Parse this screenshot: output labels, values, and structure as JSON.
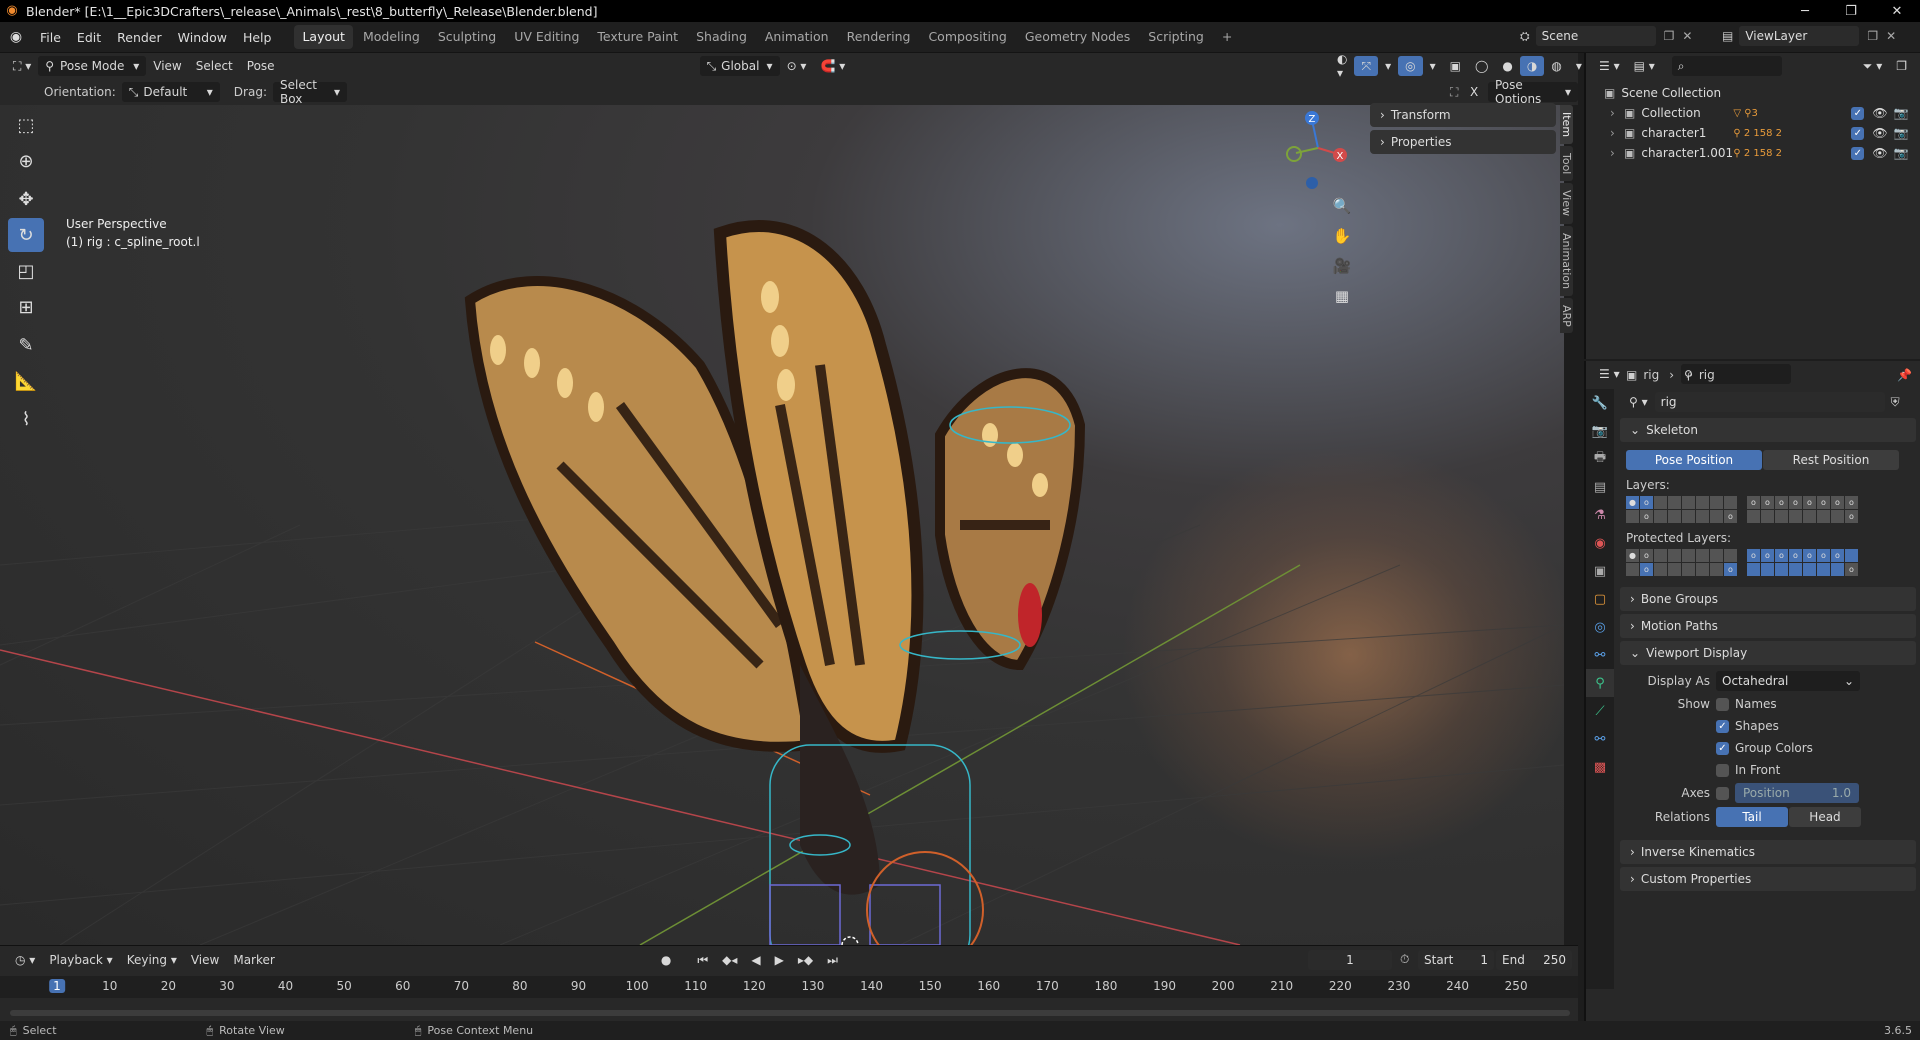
{
  "title": "Blender* [E:\\1__Epic3DCrafters\\_release\\_Animals\\_rest\\8_butterfly\\_Release\\Blender.blend]",
  "menu": [
    "File",
    "Edit",
    "Render",
    "Window",
    "Help"
  ],
  "workspaces": [
    "Layout",
    "Modeling",
    "Sculpting",
    "UV Editing",
    "Texture Paint",
    "Shading",
    "Animation",
    "Rendering",
    "Compositing",
    "Geometry Nodes",
    "Scripting"
  ],
  "scene": "Scene",
  "view_layer": "ViewLayer",
  "header": {
    "mode": "Pose Mode",
    "view": "View",
    "select": "Select",
    "pose": "Pose",
    "transform_orientation": "Global"
  },
  "tool_settings": {
    "orientation_label": "Orientation:",
    "orientation": "Default",
    "drag_label": "Drag:",
    "drag": "Select Box",
    "pose_options": "Pose Options"
  },
  "viewport": {
    "perspective": "User Perspective",
    "active": "(1) rig : c_spline_root.l"
  },
  "npanel": {
    "sections": [
      "Transform",
      "Properties"
    ],
    "tabs": [
      "Item",
      "Tool",
      "View",
      "Animation",
      "ARP"
    ]
  },
  "outliner": {
    "root": "Scene Collection",
    "items": [
      {
        "name": "Collection",
        "badge": "3"
      },
      {
        "name": "character1",
        "badge": "2 158 2"
      },
      {
        "name": "character1.001",
        "badge": "2 158 2"
      }
    ]
  },
  "properties": {
    "crumb1": "rig",
    "crumb2": "rig",
    "data_name": "rig",
    "skeleton": "Skeleton",
    "pose_position": "Pose Position",
    "rest_position": "Rest Position",
    "layers": "Layers:",
    "protected_layers": "Protected Layers:",
    "bone_groups": "Bone Groups",
    "motion_paths": "Motion Paths",
    "viewport_display": "Viewport Display",
    "display_as_label": "Display As",
    "display_as": "Octahedral",
    "show_label": "Show",
    "names": "Names",
    "shapes": "Shapes",
    "group_colors": "Group Colors",
    "in_front": "In Front",
    "axes_label": "Axes",
    "axes_position": "Position",
    "axes_value": "1.0",
    "relations_label": "Relations",
    "tail": "Tail",
    "head": "Head",
    "inverse_kinematics": "Inverse Kinematics",
    "custom_properties": "Custom Properties"
  },
  "timeline": {
    "playback": "Playback",
    "keying": "Keying",
    "view": "View",
    "marker": "Marker",
    "current_frame": "1",
    "start_label": "Start",
    "start": "1",
    "end_label": "End",
    "end": "250",
    "ticks": [
      "1",
      "10",
      "20",
      "30",
      "40",
      "50",
      "60",
      "70",
      "80",
      "90",
      "100",
      "110",
      "120",
      "130",
      "140",
      "150",
      "160",
      "170",
      "180",
      "190",
      "200",
      "210",
      "220",
      "230",
      "240",
      "250"
    ]
  },
  "status": {
    "select": "Select",
    "rotate": "Rotate View",
    "context": "Pose Context Menu",
    "version": "3.6.5"
  }
}
